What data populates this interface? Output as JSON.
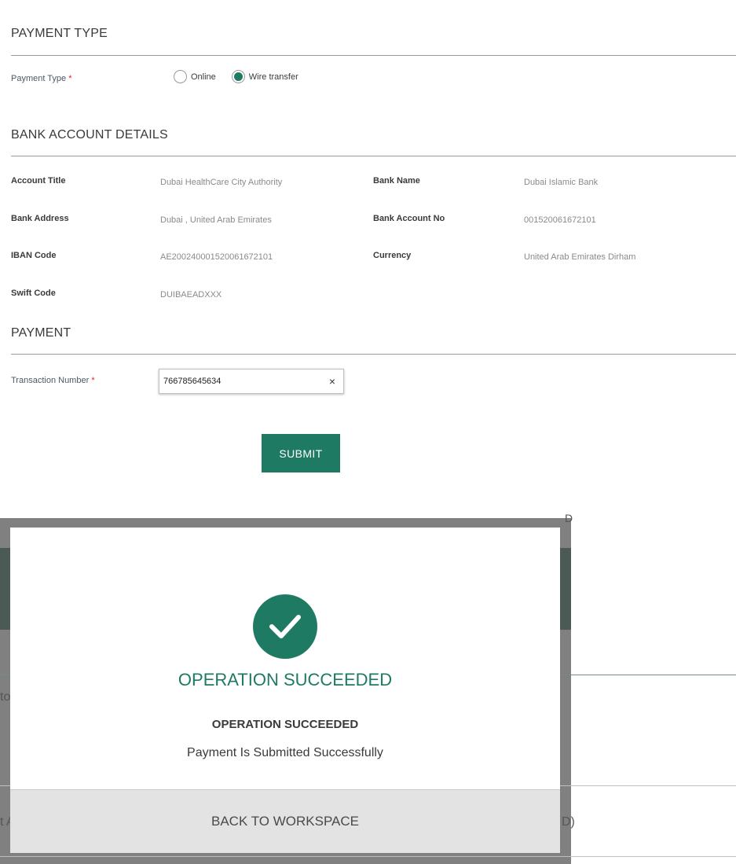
{
  "payment_type_section": {
    "title": "PAYMENT TYPE",
    "field_label": "Payment Type",
    "required_mark": "*",
    "options": [
      {
        "label": "Online",
        "selected": false
      },
      {
        "label": "Wire transfer",
        "selected": true
      }
    ]
  },
  "bank_section": {
    "title": "BANK ACCOUNT DETAILS",
    "account_title_label": "Account Title",
    "account_title_value": "Dubai HealthCare City Authority",
    "bank_name_label": "Bank Name",
    "bank_name_value": "Dubai Islamic Bank",
    "bank_address_label": "Bank Address",
    "bank_address_value": "Dubai , United Arab Emirates",
    "account_no_label": "Bank Account No",
    "account_no_value": "001520061672101",
    "iban_label": "IBAN Code",
    "iban_value": "AE200240001520061672101",
    "currency_label": "Currency",
    "currency_value": "United Arab Emirates Dirham",
    "swift_label": "Swift Code",
    "swift_value": "DUIBAEADXXX"
  },
  "payment_section": {
    "title": "PAYMENT",
    "transaction_label": "Transaction Number",
    "required_mark": "*",
    "transaction_value": "766785645634",
    "clear_glyph": "×",
    "submit_label": "SUBMIT"
  },
  "background_peek": {
    "top_right": "D",
    "left_mid": "to",
    "left_bottom": "t A",
    "right_bottom": "D)"
  },
  "modal": {
    "heading": "OPERATION SUCCEEDED",
    "subheading": "OPERATION SUCCEEDED",
    "message": "Payment Is Submitted Successfully",
    "footer_button": "BACK TO WORKSPACE",
    "icon": "check-circle-icon"
  },
  "colors": {
    "accent": "#1f7a63",
    "required": "#d9242b"
  }
}
